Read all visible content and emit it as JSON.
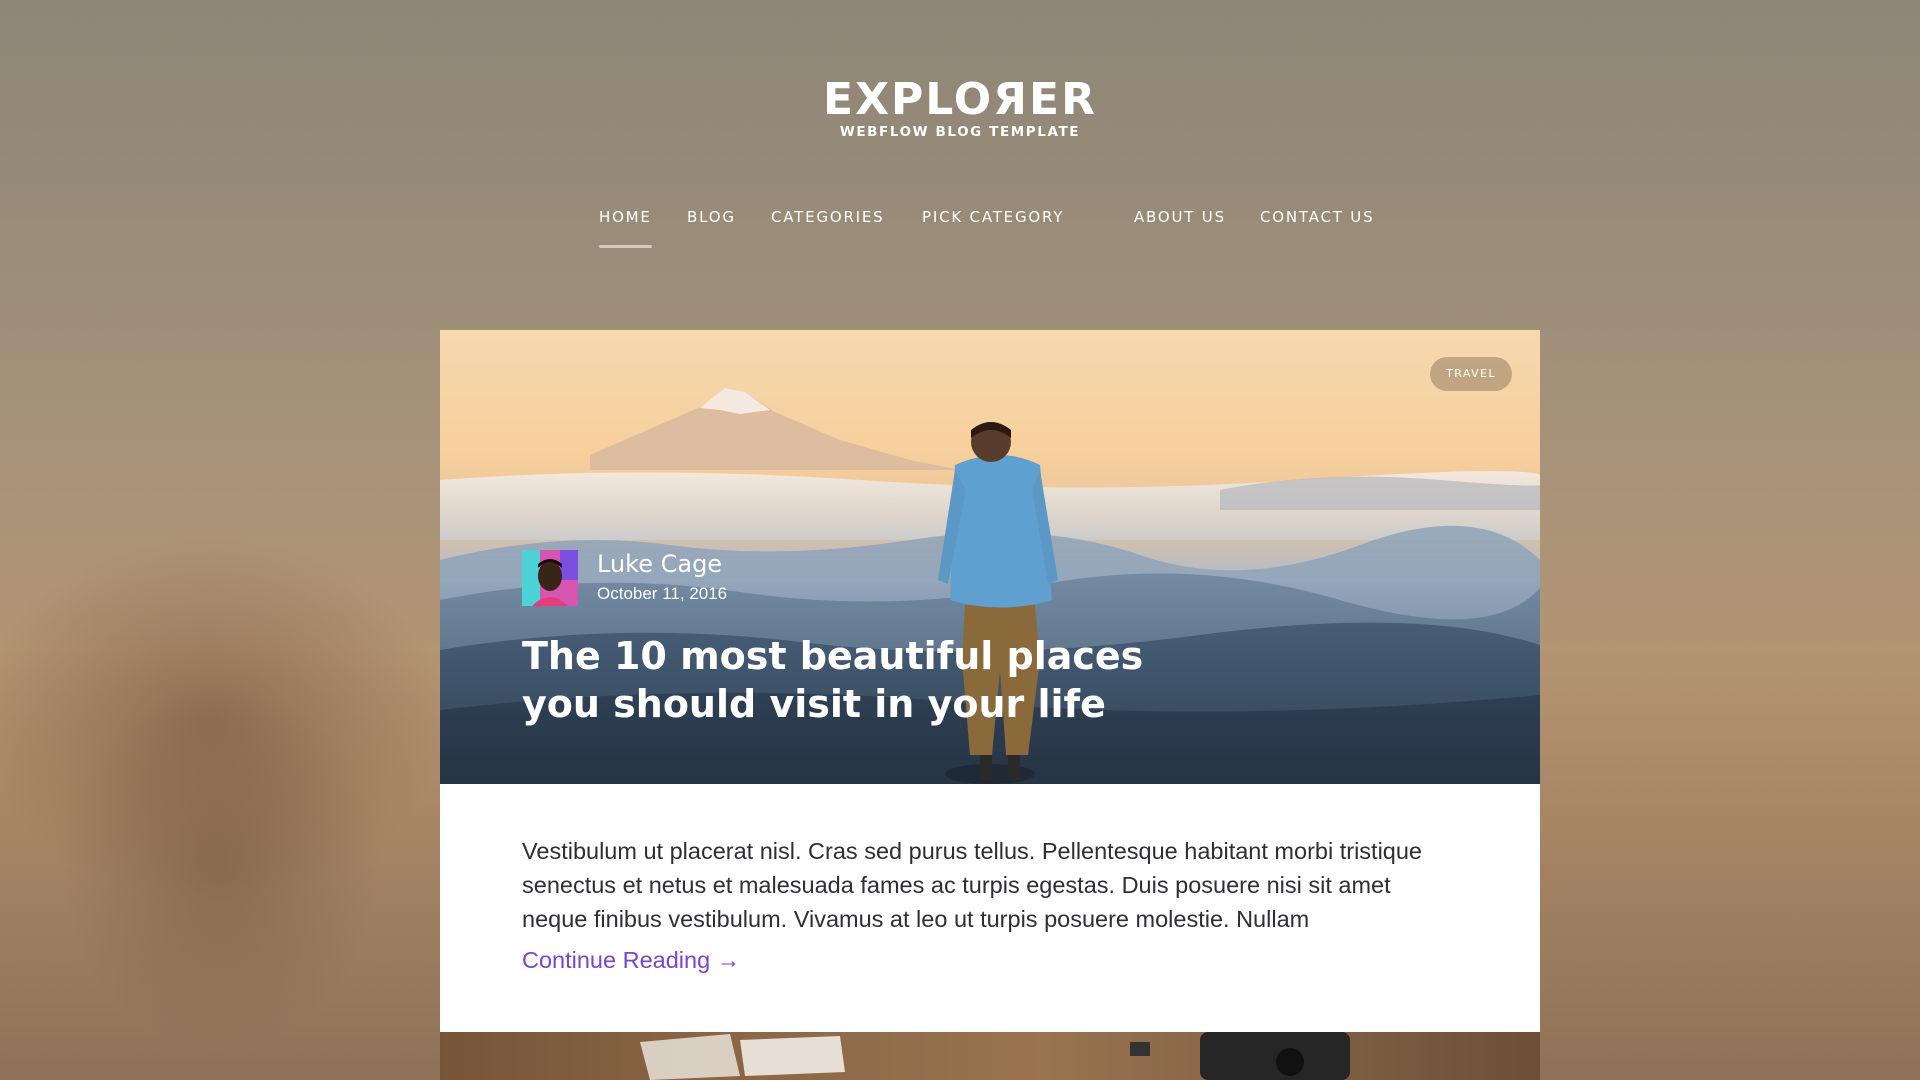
{
  "brand": {
    "title": "EXPLOЯER",
    "subtitle": "WEBFLOW BLOG TEMPLATE"
  },
  "nav": {
    "items": [
      {
        "label": "HOME",
        "active": true
      },
      {
        "label": "BLOG",
        "active": false
      },
      {
        "label": "CATEGORIES",
        "active": false
      },
      {
        "label": "PICK CATEGORY",
        "active": false
      },
      {
        "label": "ABOUT US",
        "active": false
      },
      {
        "label": "CONTACT US",
        "active": false
      }
    ]
  },
  "post": {
    "tag": "TRAVEL",
    "author": {
      "name": "Luke Cage",
      "date": "October 11, 2016"
    },
    "title": "The 10 most beautiful places you should visit in your life",
    "excerpt": "Vestibulum ut placerat nisl. Cras sed purus tellus. Pellentesque habitant morbi tristique senectus et netus et malesuada fames ac turpis egestas. Duis posuere nisi sit amet neque finibus vestibulum. Vivamus at leo ut turpis posuere molestie. Nullam",
    "continue_label": "Continue Reading →"
  },
  "colors": {
    "link": "#7a45c9",
    "body_text": "#2f2f33",
    "card_bg": "#ffffff"
  }
}
